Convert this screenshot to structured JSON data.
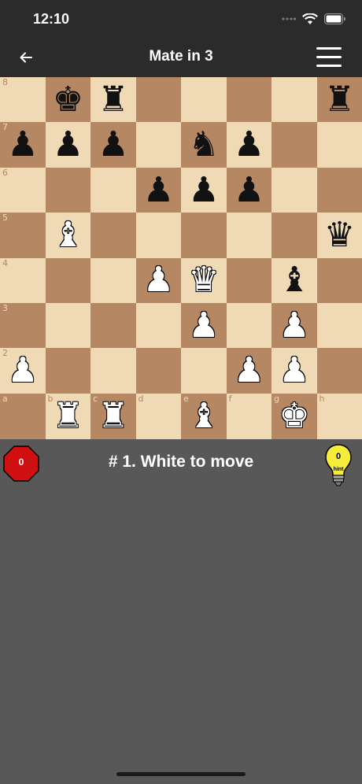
{
  "status_bar": {
    "time": "12:10"
  },
  "nav": {
    "title": "Mate in 3",
    "back_icon": "arrow-left-icon",
    "menu_icon": "hamburger-menu-icon"
  },
  "colors": {
    "light_square": "#f0d9b5",
    "dark_square": "#b58863",
    "light_coord": "#b58863",
    "dark_coord": "#f0d9b5",
    "background": "#585858",
    "counter_red": "#d01010",
    "hint_yellow": "#f6ec3a"
  },
  "board": {
    "rank_labels": [
      "8",
      "7",
      "6",
      "5",
      "4",
      "3",
      "2"
    ],
    "file_labels": [
      "a",
      "b",
      "c",
      "d",
      "e",
      "f",
      "g",
      "h"
    ],
    "pieces": [
      {
        "square": "b8",
        "type": "king",
        "color": "black"
      },
      {
        "square": "c8",
        "type": "rook",
        "color": "black"
      },
      {
        "square": "h8",
        "type": "rook",
        "color": "black"
      },
      {
        "square": "a7",
        "type": "pawn",
        "color": "black"
      },
      {
        "square": "b7",
        "type": "pawn",
        "color": "black"
      },
      {
        "square": "c7",
        "type": "pawn",
        "color": "black"
      },
      {
        "square": "e7",
        "type": "knight",
        "color": "black"
      },
      {
        "square": "f7",
        "type": "pawn",
        "color": "black"
      },
      {
        "square": "d6",
        "type": "pawn",
        "color": "black"
      },
      {
        "square": "e6",
        "type": "pawn",
        "color": "black"
      },
      {
        "square": "f6",
        "type": "pawn",
        "color": "black"
      },
      {
        "square": "b5",
        "type": "bishop",
        "color": "white"
      },
      {
        "square": "h5",
        "type": "queen",
        "color": "black"
      },
      {
        "square": "d4",
        "type": "pawn",
        "color": "white"
      },
      {
        "square": "e4",
        "type": "queen",
        "color": "white"
      },
      {
        "square": "g4",
        "type": "bishop",
        "color": "black"
      },
      {
        "square": "e3",
        "type": "pawn",
        "color": "white"
      },
      {
        "square": "g3",
        "type": "pawn",
        "color": "white"
      },
      {
        "square": "a2",
        "type": "pawn",
        "color": "white"
      },
      {
        "square": "f2",
        "type": "pawn",
        "color": "white"
      },
      {
        "square": "g2",
        "type": "pawn",
        "color": "white"
      },
      {
        "square": "b1",
        "type": "rook",
        "color": "white"
      },
      {
        "square": "c1",
        "type": "rook",
        "color": "white"
      },
      {
        "square": "e1",
        "type": "bishop",
        "color": "white"
      },
      {
        "square": "g1",
        "type": "king",
        "color": "white"
      }
    ]
  },
  "info": {
    "move_counter": "0",
    "turn_text": "# 1. White to move",
    "hint_count": "0",
    "hint_label": "hint",
    "hint_icon": "lightbulb-icon",
    "counter_icon": "stop-octagon-icon"
  }
}
